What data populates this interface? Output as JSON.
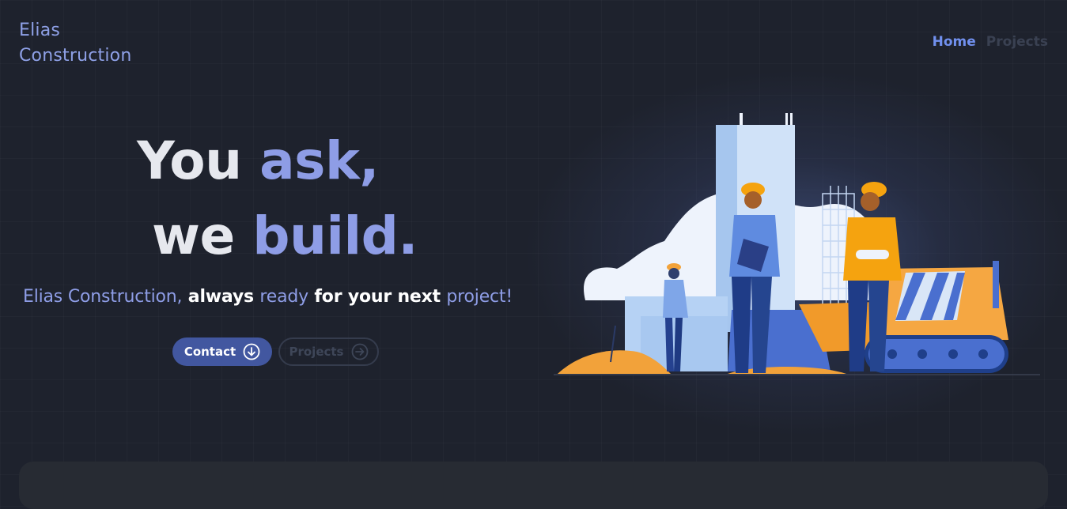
{
  "brand": {
    "line1": "Elias",
    "line2": "Construction"
  },
  "nav": {
    "home": "Home",
    "projects": "Projects"
  },
  "hero": {
    "line1_part1": "You ",
    "line1_accent": "ask,",
    "line2_part1": "we ",
    "line2_accent": "build.",
    "tagline": {
      "p1": "Elias Construction,",
      "p2": " always ",
      "p3": "ready",
      "p4": " for your next ",
      "p5": "project!"
    }
  },
  "buttons": {
    "contact": "Contact",
    "projects": "Projects"
  },
  "icons": {
    "contact_icon": "arrow-down-circle-icon",
    "projects_icon": "arrow-right-circle-icon"
  },
  "colors": {
    "background": "#1e222d",
    "accent": "#8e9de6",
    "nav_active": "#7190ee",
    "contact_button": "#4257a0",
    "illustration_orange": "#f19a2a",
    "illustration_blue": "#4a6fcf"
  }
}
